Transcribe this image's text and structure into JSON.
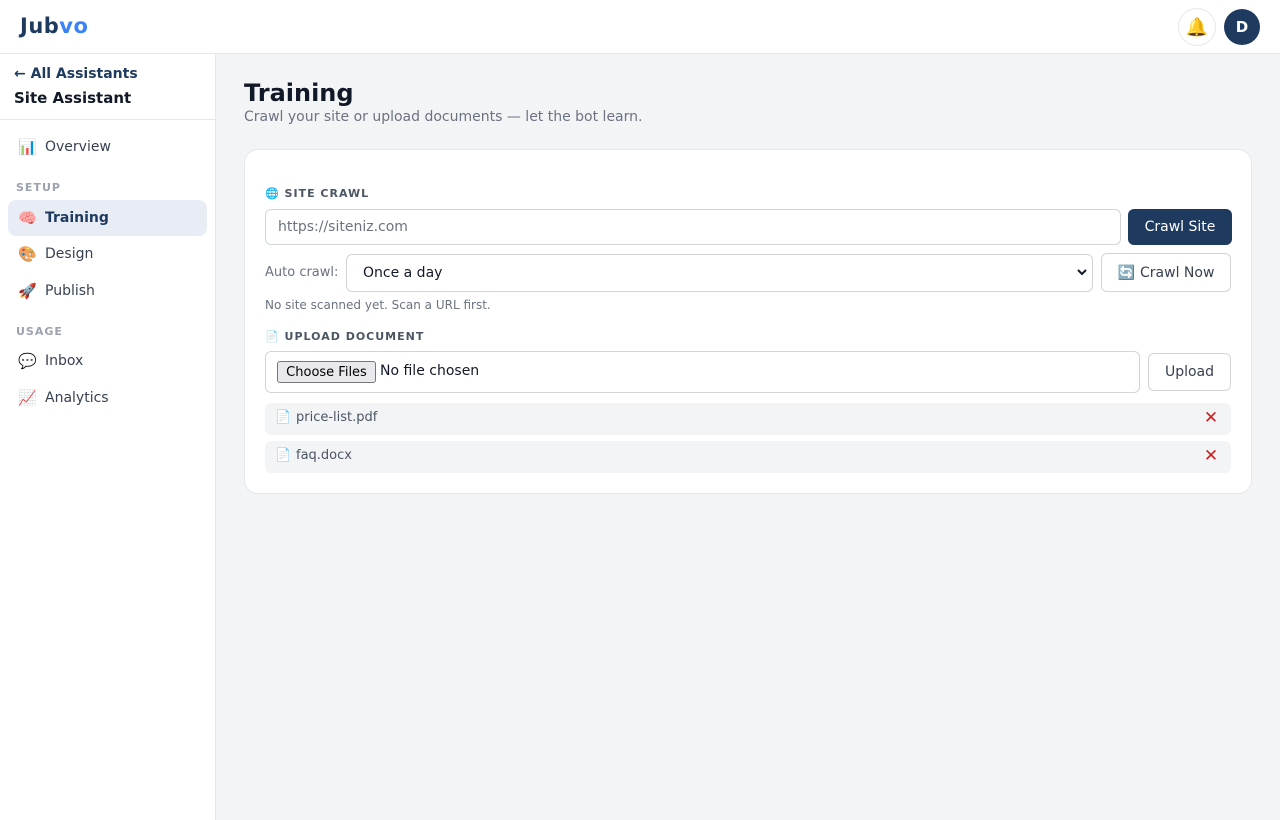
{
  "header": {
    "logo_main": "Jub",
    "logo_accent": "vo",
    "bell_icon": "🔔",
    "avatar_initial": "D"
  },
  "sidebar": {
    "back_label": "← All Assistants",
    "assistant_name": "Site Assistant",
    "overview": {
      "icon": "📊",
      "label": "Overview"
    },
    "setup_label": "SETUP",
    "setup_items": [
      {
        "icon": "🧠",
        "label": "Training",
        "active": true
      },
      {
        "icon": "🎨",
        "label": "Design"
      },
      {
        "icon": "🚀",
        "label": "Publish"
      }
    ],
    "usage_label": "USAGE",
    "usage_items": [
      {
        "icon": "💬",
        "label": "Inbox"
      },
      {
        "icon": "📈",
        "label": "Analytics"
      }
    ]
  },
  "main": {
    "title": "Training",
    "subtitle": "Crawl your site or upload documents — let the bot learn."
  },
  "crawl": {
    "section_icon": "🌐",
    "section_label": "SITE CRAWL",
    "url_placeholder": "https://siteniz.com",
    "crawl_button": "Crawl Site",
    "auto_label": "Auto crawl:",
    "auto_value": "Once a day",
    "crawl_now_icon": "🔄",
    "crawl_now_label": "Crawl Now",
    "hint": "No site scanned yet. Scan a URL first."
  },
  "upload": {
    "section_icon": "📄",
    "section_label": "UPLOAD DOCUMENT",
    "choose_label": "Choose Files",
    "file_status": "No file chosen",
    "upload_button": "Upload",
    "documents": [
      {
        "icon": "📄",
        "name": "price-list.pdf",
        "remove": "✕"
      },
      {
        "icon": "📄",
        "name": "faq.docx",
        "remove": "✕"
      }
    ]
  },
  "colors": {
    "brand": "#1e3a5f",
    "brand_accent": "#3b82f6",
    "danger": "#c81e1e",
    "active_bg": "#e8edf5"
  }
}
